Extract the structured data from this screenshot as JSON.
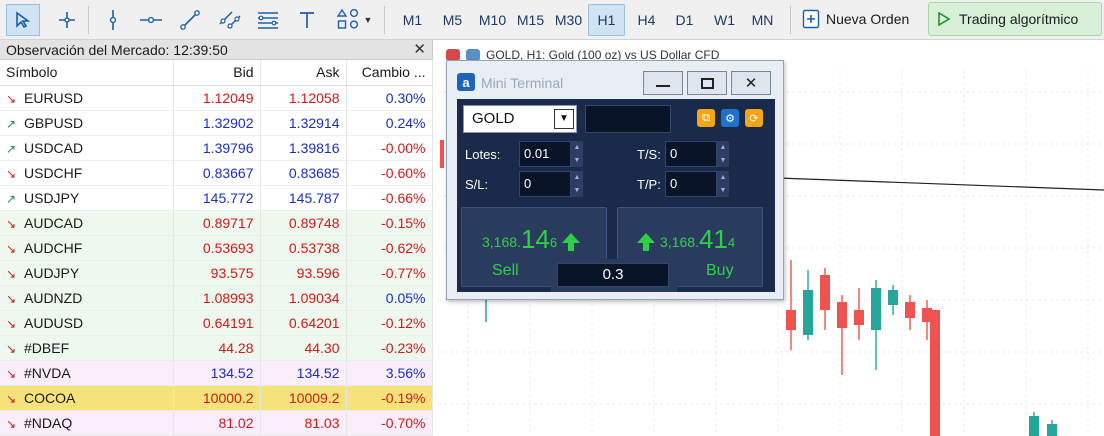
{
  "toolbar": {
    "timeframes": [
      "M1",
      "M5",
      "M10",
      "M15",
      "M30",
      "H1",
      "H4",
      "D1",
      "W1",
      "MN"
    ],
    "active_timeframe": "H1",
    "new_order_label": "Nueva Orden",
    "algo_trading_label": "Trading algorítmico"
  },
  "market_watch": {
    "title": "Observación del Mercado: 12:39:50",
    "columns": [
      "Símbolo",
      "Bid",
      "Ask",
      "Cambio ..."
    ],
    "rows": [
      {
        "symbol": "EURUSD",
        "bid": "1.12049",
        "ask": "1.12058",
        "change": "0.30%",
        "dir": "down",
        "bid_color": "red",
        "change_color": "blue",
        "bg": "w"
      },
      {
        "symbol": "GBPUSD",
        "bid": "1.32902",
        "ask": "1.32914",
        "change": "0.24%",
        "dir": "up",
        "bid_color": "blue",
        "change_color": "blue",
        "bg": "w"
      },
      {
        "symbol": "USDCAD",
        "bid": "1.39796",
        "ask": "1.39816",
        "change": "-0.00%",
        "dir": "up",
        "bid_color": "blue",
        "change_color": "red",
        "bg": "w"
      },
      {
        "symbol": "USDCHF",
        "bid": "0.83667",
        "ask": "0.83685",
        "change": "-0.60%",
        "dir": "down",
        "bid_color": "blue",
        "change_color": "red",
        "bg": "w"
      },
      {
        "symbol": "USDJPY",
        "bid": "145.772",
        "ask": "145.787",
        "change": "-0.66%",
        "dir": "up",
        "bid_color": "blue",
        "change_color": "red",
        "bg": "w"
      },
      {
        "symbol": "AUDCAD",
        "bid": "0.89717",
        "ask": "0.89748",
        "change": "-0.15%",
        "dir": "down",
        "bid_color": "red",
        "change_color": "red",
        "bg": "g"
      },
      {
        "symbol": "AUDCHF",
        "bid": "0.53693",
        "ask": "0.53738",
        "change": "-0.62%",
        "dir": "down",
        "bid_color": "red",
        "change_color": "red",
        "bg": "g"
      },
      {
        "symbol": "AUDJPY",
        "bid": "93.575",
        "ask": "93.596",
        "change": "-0.77%",
        "dir": "down",
        "bid_color": "red",
        "change_color": "red",
        "bg": "g"
      },
      {
        "symbol": "AUDNZD",
        "bid": "1.08993",
        "ask": "1.09034",
        "change": "0.05%",
        "dir": "down",
        "bid_color": "red",
        "change_color": "blue",
        "bg": "g"
      },
      {
        "symbol": "AUDUSD",
        "bid": "0.64191",
        "ask": "0.64201",
        "change": "-0.12%",
        "dir": "down",
        "bid_color": "red",
        "change_color": "red",
        "bg": "g"
      },
      {
        "symbol": "#DBEF",
        "bid": "44.28",
        "ask": "44.30",
        "change": "-0.23%",
        "dir": "down",
        "bid_color": "red",
        "change_color": "red",
        "bg": "g"
      },
      {
        "symbol": "#NVDA",
        "bid": "134.52",
        "ask": "134.52",
        "change": "3.56%",
        "dir": "down",
        "bid_color": "blue",
        "change_color": "blue",
        "bg": "p"
      },
      {
        "symbol": "COCOA",
        "bid": "10000.2",
        "ask": "10009.2",
        "change": "-0.19%",
        "dir": "down",
        "bid_color": "red",
        "change_color": "red",
        "bg": "y"
      },
      {
        "symbol": "#NDAQ",
        "bid": "81.02",
        "ask": "81.03",
        "change": "-0.70%",
        "dir": "down",
        "bid_color": "red",
        "change_color": "red",
        "bg": "p"
      }
    ]
  },
  "chart": {
    "header": "GOLD, H1:  Gold (100 oz) vs US Dollar CFD"
  },
  "mini_terminal": {
    "title": "Mini Terminal",
    "symbol": "GOLD",
    "lots_label": "Lotes:",
    "lots_value": "0.01",
    "ts_label": "T/S:",
    "ts_value": "0",
    "sl_label": "S/L:",
    "sl_value": "0",
    "tp_label": "T/P:",
    "tp_value": "0",
    "sell_price": {
      "prefix": "3,168.",
      "big": "14",
      "small": "6"
    },
    "buy_price": {
      "prefix": "3,168.",
      "big": "41",
      "small": "4"
    },
    "sell_label": "Sell",
    "buy_label": "Buy",
    "spread": "0.3"
  },
  "colors": {
    "red": "#d01a1a",
    "blue": "#1a2fc0",
    "up_arrow": "#14904a",
    "down_arrow": "#d01a1a",
    "bull": "#26a69a",
    "bear": "#ef5350"
  }
}
